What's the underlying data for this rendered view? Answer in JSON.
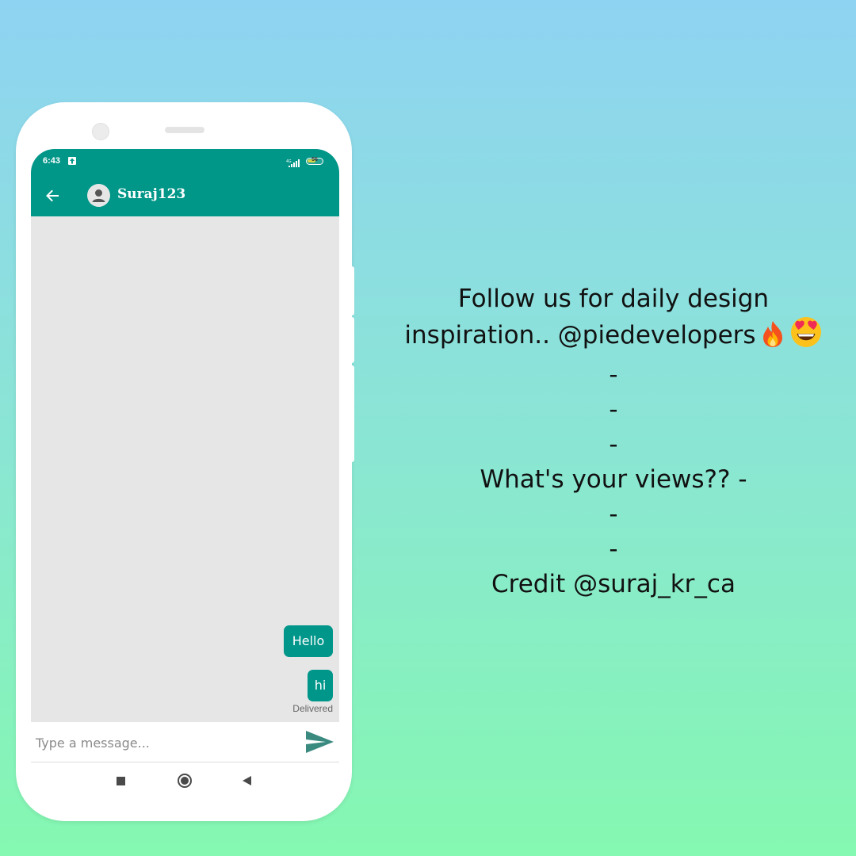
{
  "status_bar": {
    "time": "6:43",
    "battery_level": "56",
    "battery_fill_fraction": 0.56,
    "icons": [
      "upload-icon",
      "signal-icon",
      "battery-icon"
    ]
  },
  "app_bar": {
    "contact_name": "Suraj123",
    "icons": [
      "back-arrow-icon",
      "avatar-icon"
    ]
  },
  "chat": {
    "messages": [
      {
        "text": "Hello",
        "sender": "me"
      },
      {
        "text": "hi",
        "sender": "me"
      }
    ],
    "delivery_status": "Delivered"
  },
  "composer": {
    "placeholder": "Type a message...",
    "value": "",
    "send_icon": "send-icon"
  },
  "navigation": {
    "icons": [
      "recents-square-icon",
      "home-circle-icon",
      "back-triangle-icon"
    ]
  },
  "colors": {
    "primary": "#009688",
    "chat_background": "#e6e6e6",
    "bubble": "#00968a",
    "send_icon": "#3a8a80"
  },
  "promo": {
    "line1": "Follow us for daily design",
    "line2": "inspiration.. @piedevelopers",
    "line2_emojis": [
      "fire-emoji",
      "heart-eyes-emoji"
    ],
    "dash1": "-",
    "dash2": "-",
    "dash3": "-",
    "line3": "What's your views?? -",
    "dash4": "-",
    "dash5": "-",
    "line4": "Credit @suraj_kr_ca"
  }
}
